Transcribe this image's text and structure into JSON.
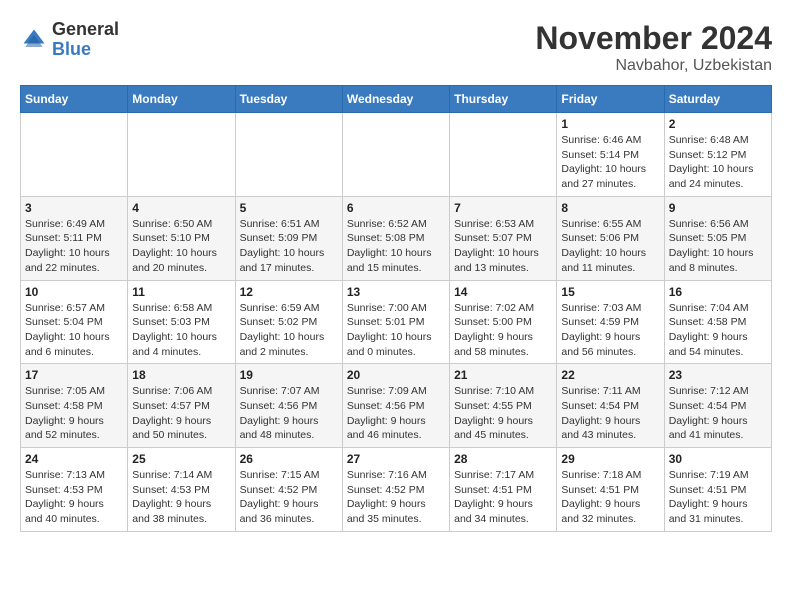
{
  "header": {
    "logo_general": "General",
    "logo_blue": "Blue",
    "month_title": "November 2024",
    "location": "Navbahor, Uzbekistan"
  },
  "days_of_week": [
    "Sunday",
    "Monday",
    "Tuesday",
    "Wednesday",
    "Thursday",
    "Friday",
    "Saturday"
  ],
  "weeks": [
    [
      {
        "day": "",
        "sunrise": "",
        "sunset": "",
        "daylight": ""
      },
      {
        "day": "",
        "sunrise": "",
        "sunset": "",
        "daylight": ""
      },
      {
        "day": "",
        "sunrise": "",
        "sunset": "",
        "daylight": ""
      },
      {
        "day": "",
        "sunrise": "",
        "sunset": "",
        "daylight": ""
      },
      {
        "day": "",
        "sunrise": "",
        "sunset": "",
        "daylight": ""
      },
      {
        "day": "1",
        "sunrise": "Sunrise: 6:46 AM",
        "sunset": "Sunset: 5:14 PM",
        "daylight": "Daylight: 10 hours and 27 minutes."
      },
      {
        "day": "2",
        "sunrise": "Sunrise: 6:48 AM",
        "sunset": "Sunset: 5:12 PM",
        "daylight": "Daylight: 10 hours and 24 minutes."
      }
    ],
    [
      {
        "day": "3",
        "sunrise": "Sunrise: 6:49 AM",
        "sunset": "Sunset: 5:11 PM",
        "daylight": "Daylight: 10 hours and 22 minutes."
      },
      {
        "day": "4",
        "sunrise": "Sunrise: 6:50 AM",
        "sunset": "Sunset: 5:10 PM",
        "daylight": "Daylight: 10 hours and 20 minutes."
      },
      {
        "day": "5",
        "sunrise": "Sunrise: 6:51 AM",
        "sunset": "Sunset: 5:09 PM",
        "daylight": "Daylight: 10 hours and 17 minutes."
      },
      {
        "day": "6",
        "sunrise": "Sunrise: 6:52 AM",
        "sunset": "Sunset: 5:08 PM",
        "daylight": "Daylight: 10 hours and 15 minutes."
      },
      {
        "day": "7",
        "sunrise": "Sunrise: 6:53 AM",
        "sunset": "Sunset: 5:07 PM",
        "daylight": "Daylight: 10 hours and 13 minutes."
      },
      {
        "day": "8",
        "sunrise": "Sunrise: 6:55 AM",
        "sunset": "Sunset: 5:06 PM",
        "daylight": "Daylight: 10 hours and 11 minutes."
      },
      {
        "day": "9",
        "sunrise": "Sunrise: 6:56 AM",
        "sunset": "Sunset: 5:05 PM",
        "daylight": "Daylight: 10 hours and 8 minutes."
      }
    ],
    [
      {
        "day": "10",
        "sunrise": "Sunrise: 6:57 AM",
        "sunset": "Sunset: 5:04 PM",
        "daylight": "Daylight: 10 hours and 6 minutes."
      },
      {
        "day": "11",
        "sunrise": "Sunrise: 6:58 AM",
        "sunset": "Sunset: 5:03 PM",
        "daylight": "Daylight: 10 hours and 4 minutes."
      },
      {
        "day": "12",
        "sunrise": "Sunrise: 6:59 AM",
        "sunset": "Sunset: 5:02 PM",
        "daylight": "Daylight: 10 hours and 2 minutes."
      },
      {
        "day": "13",
        "sunrise": "Sunrise: 7:00 AM",
        "sunset": "Sunset: 5:01 PM",
        "daylight": "Daylight: 10 hours and 0 minutes."
      },
      {
        "day": "14",
        "sunrise": "Sunrise: 7:02 AM",
        "sunset": "Sunset: 5:00 PM",
        "daylight": "Daylight: 9 hours and 58 minutes."
      },
      {
        "day": "15",
        "sunrise": "Sunrise: 7:03 AM",
        "sunset": "Sunset: 4:59 PM",
        "daylight": "Daylight: 9 hours and 56 minutes."
      },
      {
        "day": "16",
        "sunrise": "Sunrise: 7:04 AM",
        "sunset": "Sunset: 4:58 PM",
        "daylight": "Daylight: 9 hours and 54 minutes."
      }
    ],
    [
      {
        "day": "17",
        "sunrise": "Sunrise: 7:05 AM",
        "sunset": "Sunset: 4:58 PM",
        "daylight": "Daylight: 9 hours and 52 minutes."
      },
      {
        "day": "18",
        "sunrise": "Sunrise: 7:06 AM",
        "sunset": "Sunset: 4:57 PM",
        "daylight": "Daylight: 9 hours and 50 minutes."
      },
      {
        "day": "19",
        "sunrise": "Sunrise: 7:07 AM",
        "sunset": "Sunset: 4:56 PM",
        "daylight": "Daylight: 9 hours and 48 minutes."
      },
      {
        "day": "20",
        "sunrise": "Sunrise: 7:09 AM",
        "sunset": "Sunset: 4:56 PM",
        "daylight": "Daylight: 9 hours and 46 minutes."
      },
      {
        "day": "21",
        "sunrise": "Sunrise: 7:10 AM",
        "sunset": "Sunset: 4:55 PM",
        "daylight": "Daylight: 9 hours and 45 minutes."
      },
      {
        "day": "22",
        "sunrise": "Sunrise: 7:11 AM",
        "sunset": "Sunset: 4:54 PM",
        "daylight": "Daylight: 9 hours and 43 minutes."
      },
      {
        "day": "23",
        "sunrise": "Sunrise: 7:12 AM",
        "sunset": "Sunset: 4:54 PM",
        "daylight": "Daylight: 9 hours and 41 minutes."
      }
    ],
    [
      {
        "day": "24",
        "sunrise": "Sunrise: 7:13 AM",
        "sunset": "Sunset: 4:53 PM",
        "daylight": "Daylight: 9 hours and 40 minutes."
      },
      {
        "day": "25",
        "sunrise": "Sunrise: 7:14 AM",
        "sunset": "Sunset: 4:53 PM",
        "daylight": "Daylight: 9 hours and 38 minutes."
      },
      {
        "day": "26",
        "sunrise": "Sunrise: 7:15 AM",
        "sunset": "Sunset: 4:52 PM",
        "daylight": "Daylight: 9 hours and 36 minutes."
      },
      {
        "day": "27",
        "sunrise": "Sunrise: 7:16 AM",
        "sunset": "Sunset: 4:52 PM",
        "daylight": "Daylight: 9 hours and 35 minutes."
      },
      {
        "day": "28",
        "sunrise": "Sunrise: 7:17 AM",
        "sunset": "Sunset: 4:51 PM",
        "daylight": "Daylight: 9 hours and 34 minutes."
      },
      {
        "day": "29",
        "sunrise": "Sunrise: 7:18 AM",
        "sunset": "Sunset: 4:51 PM",
        "daylight": "Daylight: 9 hours and 32 minutes."
      },
      {
        "day": "30",
        "sunrise": "Sunrise: 7:19 AM",
        "sunset": "Sunset: 4:51 PM",
        "daylight": "Daylight: 9 hours and 31 minutes."
      }
    ]
  ]
}
